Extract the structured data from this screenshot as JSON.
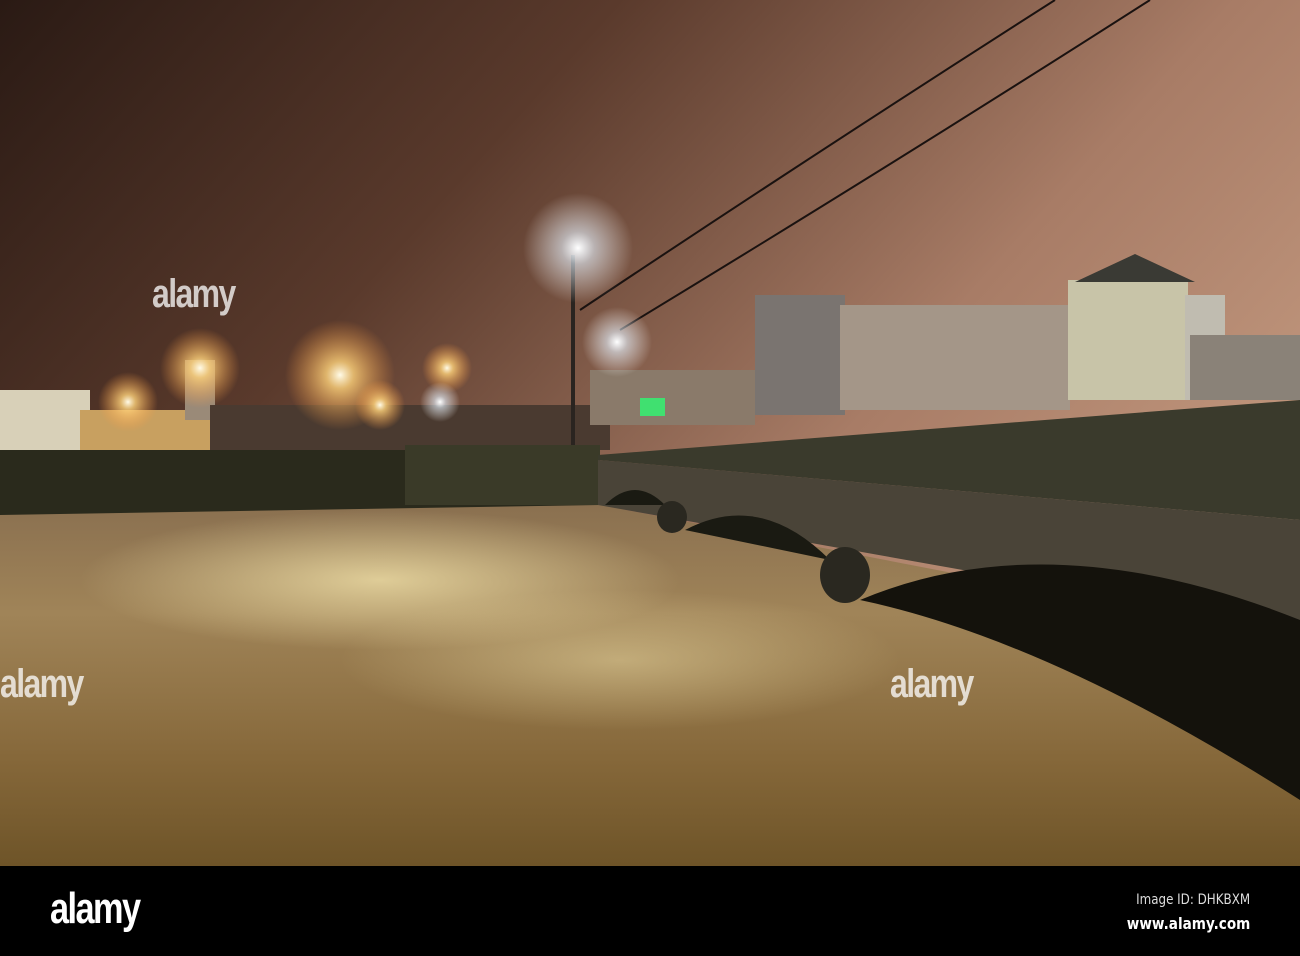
{
  "photo": {
    "subject": "night-river-bridge-town"
  },
  "watermark": {
    "text": "alamy"
  },
  "footer": {
    "logo": "alamy",
    "image_id": "Image ID: DHKBXM",
    "url": "www.alamy.com"
  }
}
